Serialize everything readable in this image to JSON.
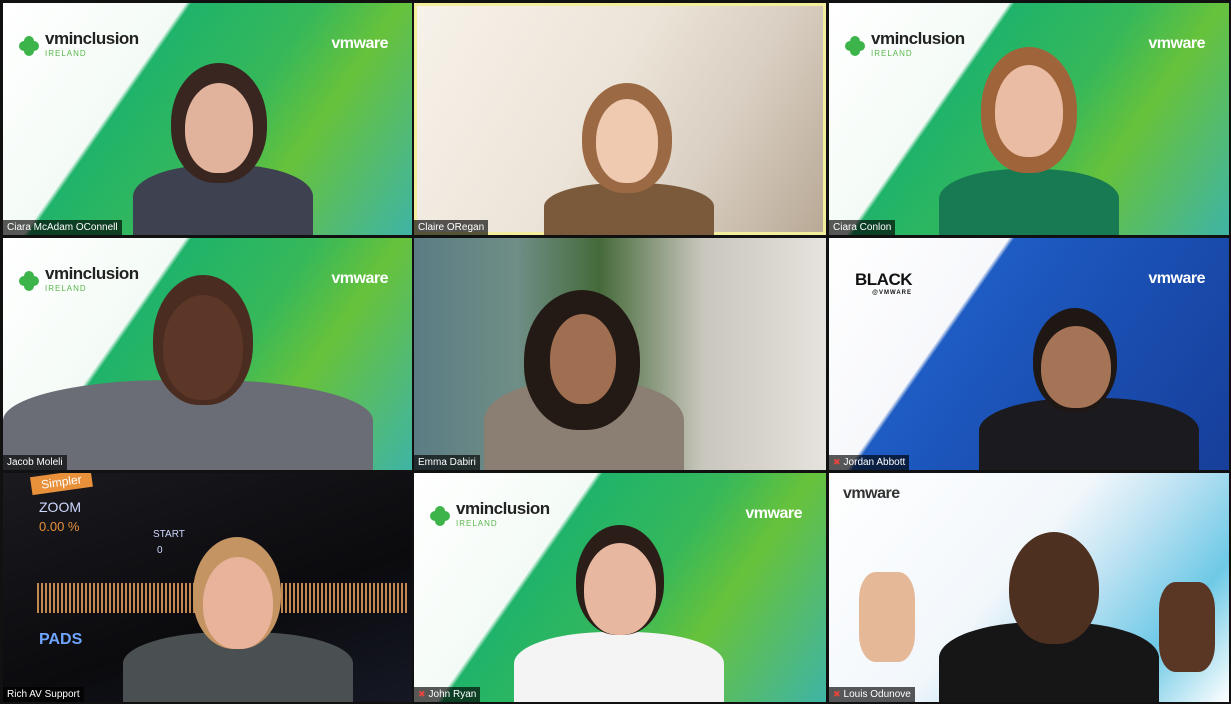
{
  "call": {
    "tiles": [
      {
        "name": "Ciara McAdam OConnell",
        "background": "vminclusion"
      },
      {
        "name": "Claire ORegan",
        "background": "room",
        "active_speaker": true
      },
      {
        "name": "Ciara Conlon",
        "background": "vminclusion"
      },
      {
        "name": "Jacob Moleli",
        "background": "vminclusion"
      },
      {
        "name": "Emma Dabiri",
        "background": "room-plants"
      },
      {
        "name": "Jordan Abbott",
        "background": "black-vmware",
        "muted": true
      },
      {
        "name": "Rich AV Support",
        "background": "audio-software"
      },
      {
        "name": "John Ryan",
        "background": "vminclusion",
        "muted": true
      },
      {
        "name": "Louis Odunove",
        "background": "vmware-light",
        "muted": true
      }
    ]
  },
  "branding": {
    "vminclusion_main": "vminclusion",
    "vminclusion_sub": "IRELAND",
    "vmware": "vmware",
    "black_logo": "BLACK",
    "black_sub": "@VMWARE"
  },
  "av_overlay": {
    "simpler": "Simpler",
    "zoom": "ZOOM",
    "zoom_value": "0.00 %",
    "start": "START",
    "start_value": "0",
    "pads": "PADS"
  },
  "colors": {
    "active_outline": "#f2ee9c",
    "vm_green": "#36b85a",
    "vm_blue": "#1e5cc4",
    "mute_icon": "#e8453c"
  }
}
